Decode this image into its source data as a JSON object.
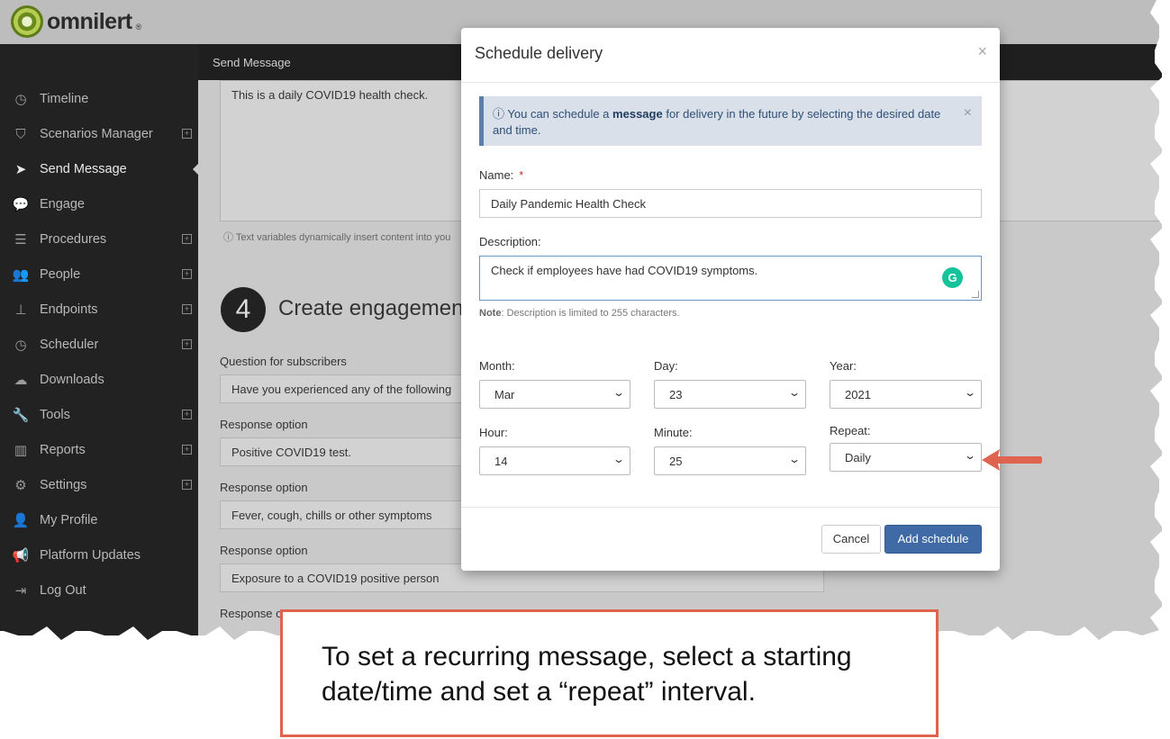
{
  "brand": {
    "name": "omnilert",
    "reg_mark": "®"
  },
  "header": {
    "title": "Send Message"
  },
  "sidebar": {
    "items": [
      {
        "label": "Timeline",
        "icon": "clock-icon",
        "expandable": false
      },
      {
        "label": "Scenarios Manager",
        "icon": "shield-icon",
        "expandable": true
      },
      {
        "label": "Send Message",
        "icon": "paper-plane-icon",
        "expandable": false,
        "active": true
      },
      {
        "label": "Engage",
        "icon": "chat-bubbles-icon",
        "expandable": false
      },
      {
        "label": "Procedures",
        "icon": "list-icon",
        "expandable": true
      },
      {
        "label": "People",
        "icon": "users-icon",
        "expandable": true
      },
      {
        "label": "Endpoints",
        "icon": "sitemap-icon",
        "expandable": true
      },
      {
        "label": "Scheduler",
        "icon": "clock-icon",
        "expandable": true
      },
      {
        "label": "Downloads",
        "icon": "cloud-download-icon",
        "expandable": false
      },
      {
        "label": "Tools",
        "icon": "wrench-icon",
        "expandable": true
      },
      {
        "label": "Reports",
        "icon": "bar-chart-icon",
        "expandable": true
      },
      {
        "label": "Settings",
        "icon": "gear-icon",
        "expandable": true
      },
      {
        "label": "My Profile",
        "icon": "user-icon",
        "expandable": false
      },
      {
        "label": "Platform Updates",
        "icon": "megaphone-icon",
        "expandable": false
      },
      {
        "label": "Log Out",
        "icon": "sign-out-icon",
        "expandable": false
      }
    ]
  },
  "main": {
    "message_text": "This is a daily COVID19 health check.",
    "variables_note": "Text variables dynamically insert content into you",
    "step": {
      "number": "4",
      "title": "Create engagement"
    },
    "question_label": "Question for subscribers",
    "question_value": "Have you experienced any of the following",
    "response_label": "Response option",
    "response_options": [
      "Positive COVID19 test.",
      "Fever, cough, chills or other symptoms",
      "Exposure to a COVID19 positive person"
    ],
    "partial_label": "Response o"
  },
  "modal": {
    "title": "Schedule delivery",
    "close": "×",
    "alert": {
      "icon": "info-circle-icon",
      "text_before": "You can schedule a",
      "text_bold": "message",
      "text_after": "for delivery in the future by selecting the desired date and time.",
      "close": "×"
    },
    "name_label": "Name:",
    "required_mark": "*",
    "name_value": "Daily Pandemic Health Check",
    "description_label": "Description:",
    "description_value": "Check if employees have had COVID19 symptoms.",
    "note_bold": "Note",
    "note_text": ": Description is limited to 255 characters.",
    "month_label": "Month:",
    "month_value": "Mar",
    "day_label": "Day:",
    "day_value": "23",
    "year_label": "Year:",
    "year_value": "2021",
    "hour_label": "Hour:",
    "hour_value": "14",
    "minute_label": "Minute:",
    "minute_value": "25",
    "repeat_label": "Repeat:",
    "repeat_value": "Daily",
    "cancel_label": "Cancel",
    "add_label": "Add schedule"
  },
  "callout": {
    "text": "To set a recurring message, select a starting date/time and set a “repeat” interval.",
    "border_color": "#de6450",
    "arrow_color": "#de6450"
  }
}
